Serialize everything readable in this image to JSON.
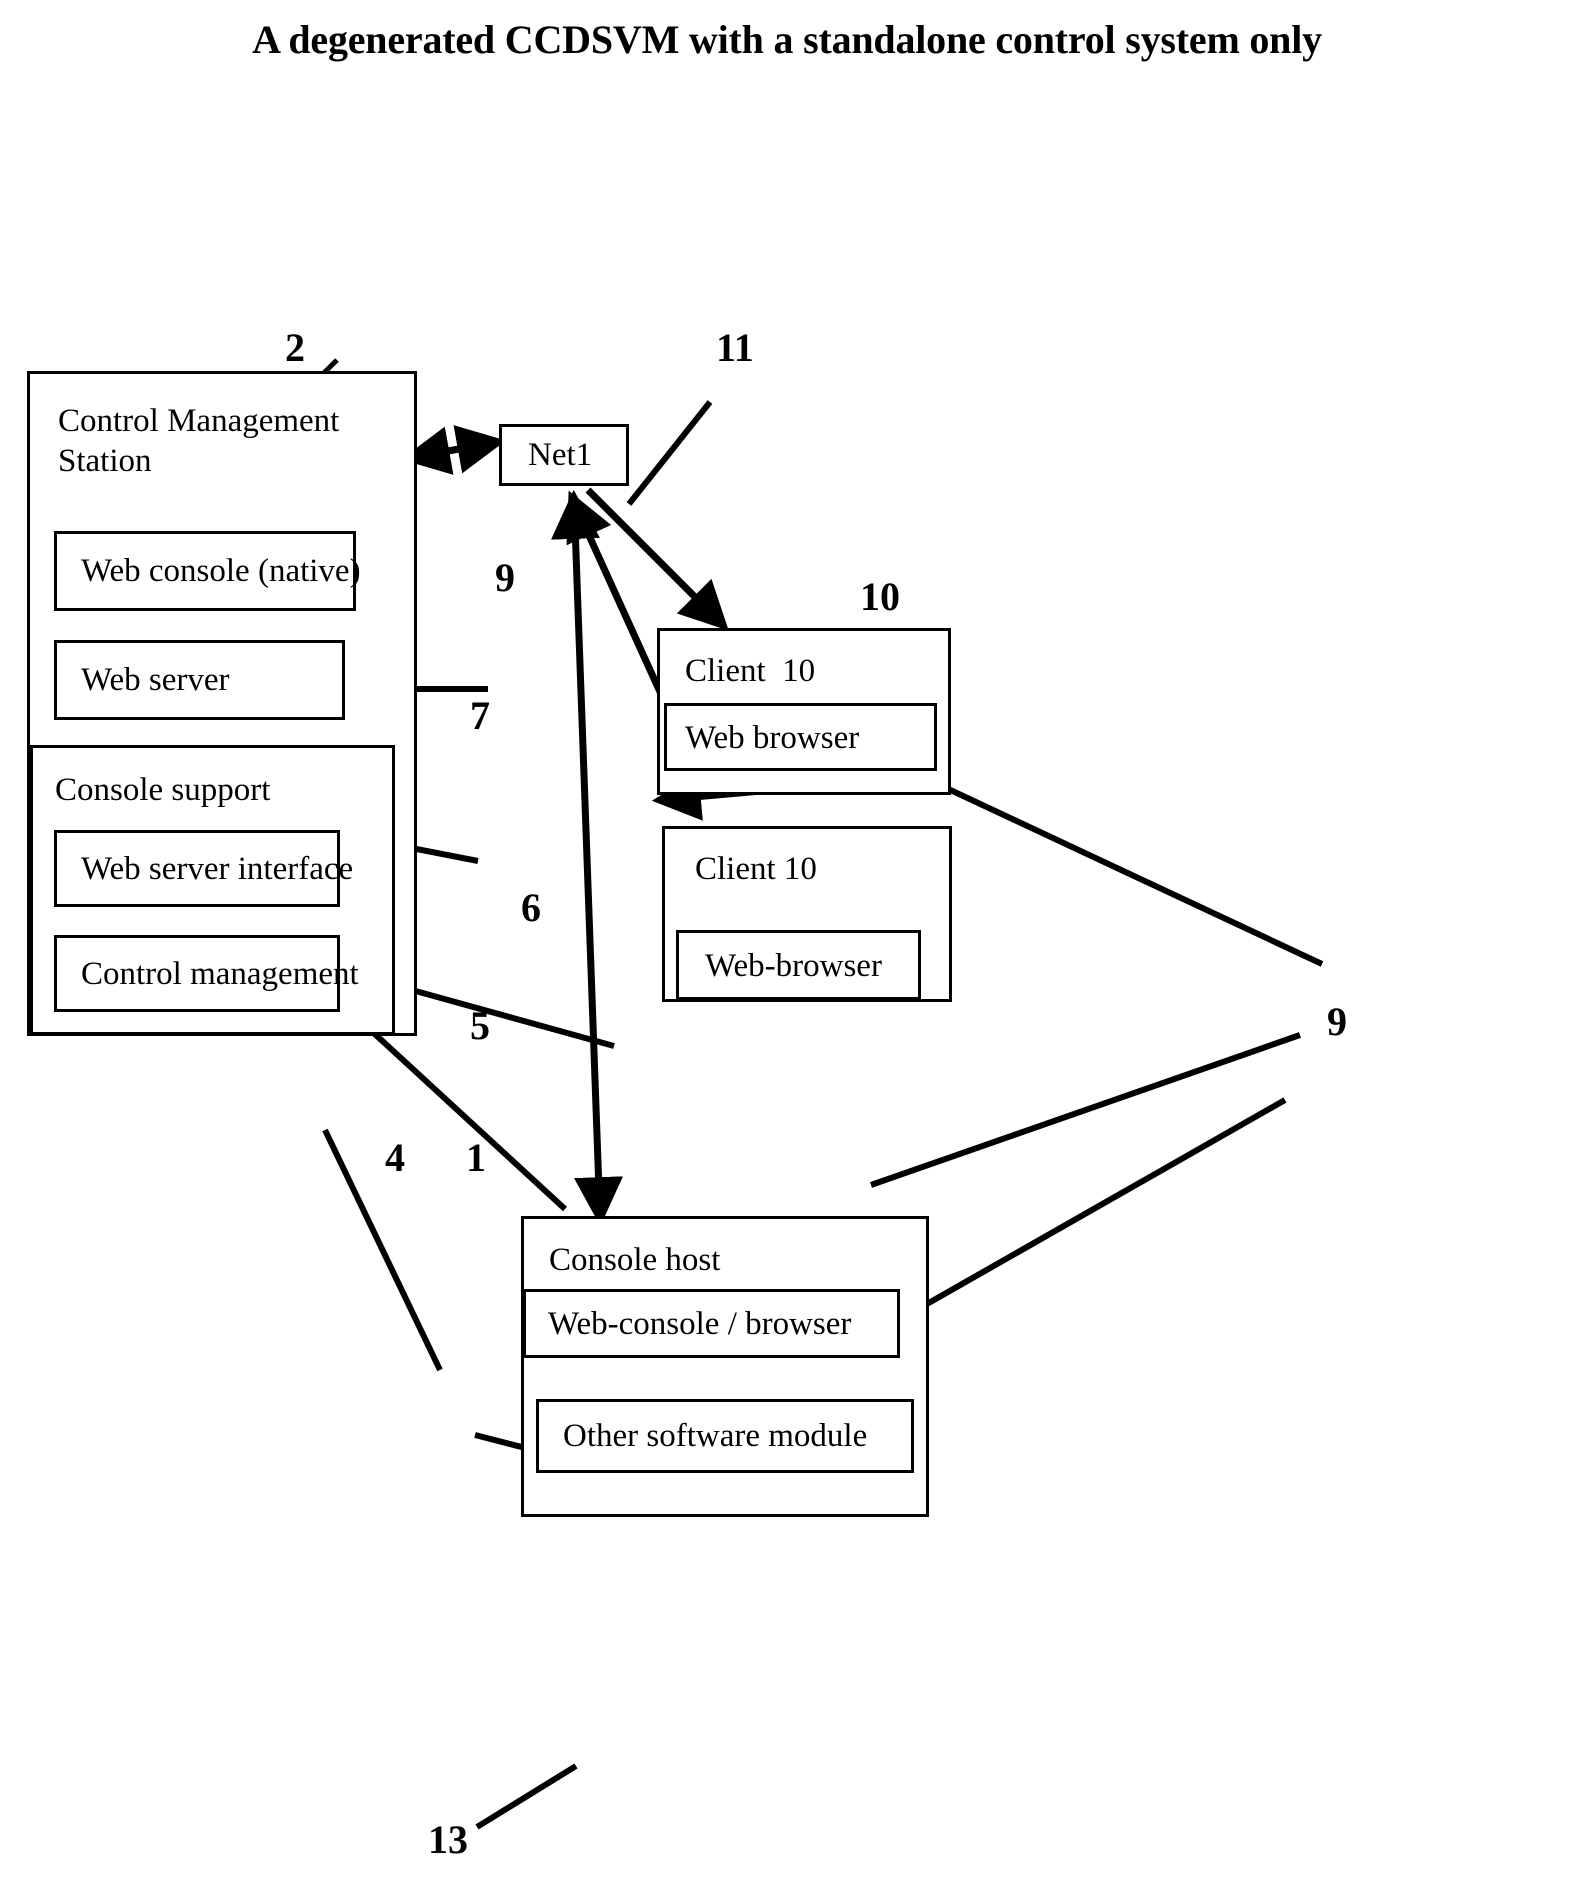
{
  "figure": {
    "title": "A degenerated CCDSVM with a standalone control system only"
  },
  "boxes": {
    "control_management_station": {
      "title": "Control Management\nStation",
      "children": {
        "web_console_native": "Web console (native)",
        "web_server": "Web server",
        "console_support": {
          "title": "Console support",
          "children": {
            "web_server_interface": "Web server interface",
            "control_management": "Control management"
          }
        }
      }
    },
    "net1": "Net1",
    "client_a": {
      "title": "Client  10",
      "children": {
        "web_browser": "Web browser"
      }
    },
    "client_b": {
      "title": "Client 10",
      "children": {
        "web_browser": "Web-browser"
      }
    },
    "console_host": {
      "title": "Console host",
      "children": {
        "web_console_browser": "Web-console / browser",
        "other_software_module": "Other software module"
      }
    }
  },
  "reference_numbers": {
    "cms": "2",
    "net1": "11",
    "web_console_native": "9",
    "web_server": "7",
    "console_support": "6",
    "control_management": "5",
    "web_server_interface": "4",
    "console_host": "1",
    "client_group": "10",
    "browsers": "9",
    "other_software_module": "13"
  },
  "colors": {
    "stroke": "#000000",
    "background": "#ffffff"
  }
}
